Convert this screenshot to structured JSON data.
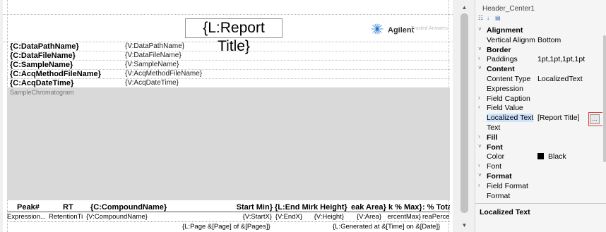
{
  "report": {
    "title": "{L:Report Title}",
    "logo_text": "Agilent",
    "logo_tagline": "Trusted Answers",
    "header_rows": [
      {
        "caption": "{C:DataPathName}",
        "value": "{V:DataPathName}"
      },
      {
        "caption": "{C:DataFileName}",
        "value": "{V:DataFileName}"
      },
      {
        "caption": "{C:SampleName}",
        "value": "{V:SampleName}"
      },
      {
        "caption": "{C:AcqMethodFileName}",
        "value": "{V:AcqMethodFileName}"
      },
      {
        "caption": "{C:AcqDateTime}",
        "value": "{V:AcqDateTime}"
      }
    ],
    "chromatogram_label": "SampleChromatogram",
    "table_headers": [
      "Peak#",
      "RT",
      "{C:CompoundName}",
      "Start Min}",
      "{L:End Min",
      "k Height}",
      "eak Area}",
      "k % Max}",
      ": % Total}"
    ],
    "table_values": [
      "Expression...",
      "RetentionTi",
      "{V:CompoundName}",
      "{V:StartX}",
      "{V:EndX}",
      "{V:Height}",
      "{V:Area}",
      "ercentMax}",
      "reaPercent}"
    ],
    "footer_left": "{L:Page &[Page] of &[Pages]}",
    "footer_right": "{L:Generated at &[Time] on &[Date]}"
  },
  "properties": {
    "object_name": "Header_Center1",
    "items": [
      {
        "kind": "category",
        "name": "Alignment",
        "expander": "˅"
      },
      {
        "kind": "prop",
        "name": "Vertical Alignm",
        "value": "Bottom",
        "expander": ""
      },
      {
        "kind": "category",
        "name": "Border",
        "expander": "˅"
      },
      {
        "kind": "prop",
        "name": "Paddings",
        "value": "1pt,1pt,1pt,1pt",
        "expander": "›"
      },
      {
        "kind": "category",
        "name": "Content",
        "expander": "˅"
      },
      {
        "kind": "prop",
        "name": "Content Type",
        "value": "LocalizedText",
        "expander": ""
      },
      {
        "kind": "prop",
        "name": "Expression",
        "value": "",
        "expander": ""
      },
      {
        "kind": "prop",
        "name": "Field Caption",
        "value": "",
        "expander": "›"
      },
      {
        "kind": "prop",
        "name": "Field Value",
        "value": "",
        "expander": "›"
      },
      {
        "kind": "selected",
        "name": "Localized Text",
        "value": "[Report Title]",
        "expander": ""
      },
      {
        "kind": "prop",
        "name": "Text",
        "value": "",
        "expander": ""
      },
      {
        "kind": "category",
        "name": "Fill",
        "expander": "›"
      },
      {
        "kind": "category",
        "name": "Font",
        "expander": "˅"
      },
      {
        "kind": "color",
        "name": "Color",
        "value": "Black",
        "expander": ""
      },
      {
        "kind": "prop",
        "name": "Font",
        "value": "",
        "expander": "›"
      },
      {
        "kind": "category",
        "name": "Format",
        "expander": "˅"
      },
      {
        "kind": "prop",
        "name": "Field Format",
        "value": "",
        "expander": "›"
      },
      {
        "kind": "prop",
        "name": "Format",
        "value": "",
        "expander": ""
      }
    ],
    "ellipsis_label": "...",
    "description_title": "Localized Text",
    "toolbar_icons": [
      "categorized-icon",
      "alphabetical-icon",
      "property-pages-icon"
    ]
  },
  "colors": {
    "selection": "#cfe3fb",
    "highlight_box": "#e03b3b",
    "chromatogram_bg": "#d9d9d9",
    "logo_accent": "#4a90d9"
  }
}
